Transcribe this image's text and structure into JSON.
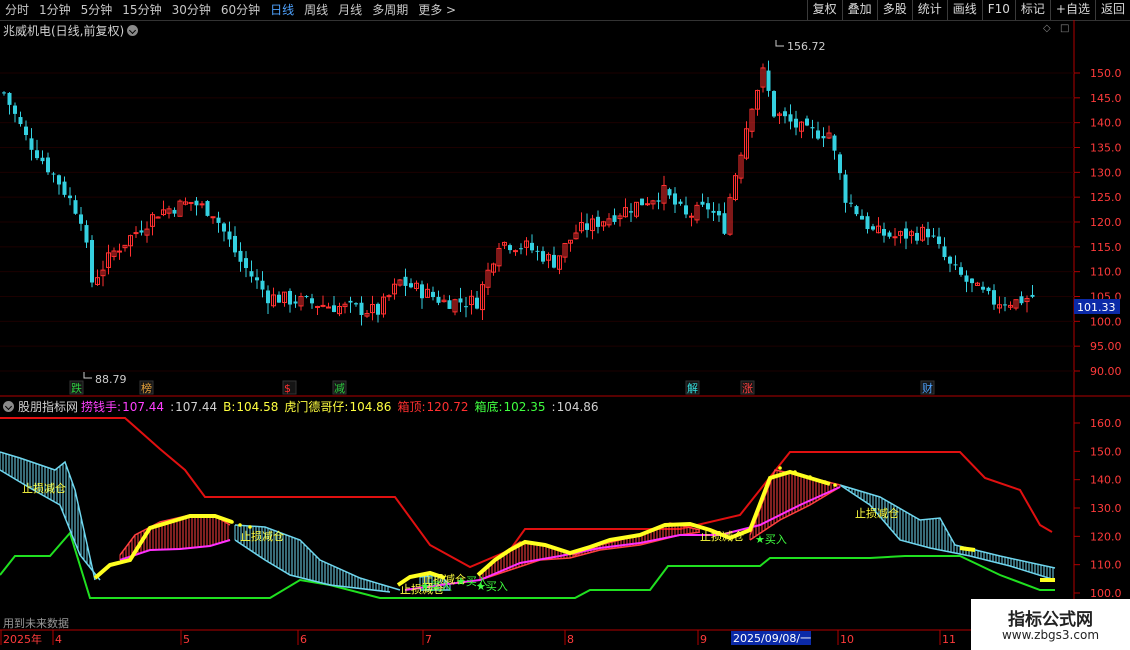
{
  "toolbar": {
    "periods": [
      {
        "label": "分时",
        "active": false
      },
      {
        "label": "1分钟",
        "active": false
      },
      {
        "label": "5分钟",
        "active": false
      },
      {
        "label": "15分钟",
        "active": false
      },
      {
        "label": "30分钟",
        "active": false
      },
      {
        "label": "60分钟",
        "active": false
      },
      {
        "label": "日线",
        "active": true
      },
      {
        "label": "周线",
        "active": false
      },
      {
        "label": "月线",
        "active": false
      },
      {
        "label": "多周期",
        "active": false
      },
      {
        "label": "更多 >",
        "active": false
      }
    ],
    "buttons": [
      "复权",
      "叠加",
      "多股",
      "统计",
      "画线",
      "F10",
      "标记",
      "+自选",
      "返回"
    ]
  },
  "stock": {
    "title": "兆威机电(日线,前复权)",
    "high_label": "156.72",
    "low_label": "88.79",
    "current_price": "101.33",
    "price_ticks": [
      "150.0",
      "145.0",
      "140.0",
      "135.0",
      "130.0",
      "125.0",
      "120.0",
      "115.0",
      "110.0",
      "105.0",
      "100.0",
      "95.00",
      "90.00"
    ],
    "event_markers": [
      {
        "text": "跌",
        "color": "#2ecc40"
      },
      {
        "text": "榜",
        "color": "#e6a23c"
      },
      {
        "text": "$",
        "color": "#ff3030"
      },
      {
        "text": "减",
        "color": "#2ecc40"
      },
      {
        "text": "解",
        "color": "#35e0e0"
      },
      {
        "text": "涨",
        "color": "#ff4040"
      },
      {
        "text": "财",
        "color": "#4fa3ff"
      }
    ]
  },
  "indicator": {
    "name": "股朋指标网",
    "items": [
      {
        "label": "捞钱手:",
        "value": "107.44",
        "color": "#ff40ff"
      },
      {
        "label": ":",
        "value": "107.44",
        "color": "#d0d0d0"
      },
      {
        "label": "B:",
        "value": "104.58",
        "color": "#ffff40"
      },
      {
        "label": "虎门德哥仔:",
        "value": "104.86",
        "color": "#ffff40"
      },
      {
        "label": "箱顶:",
        "value": "120.72",
        "color": "#ff3030"
      },
      {
        "label": "箱底:",
        "value": "102.35",
        "color": "#40ff40"
      },
      {
        "label": ":",
        "value": "104.86",
        "color": "#d0d0d0"
      }
    ],
    "ticks": [
      "160.0",
      "150.0",
      "140.0",
      "130.0",
      "120.0",
      "110.0",
      "100.0"
    ],
    "labels": [
      {
        "text": "止损减仓",
        "color": "#ffff40"
      },
      {
        "text": "止损减仓",
        "color": "#ffff40"
      },
      {
        "text": "止损减仓",
        "color": "#ffff40"
      },
      {
        "text": "止损减仓",
        "color": "#ffff40"
      },
      {
        "text": "止损减仓",
        "color": "#ffff40"
      },
      {
        "text": "止损减仓",
        "color": "#ffff40"
      },
      {
        "text": "★买入",
        "color": "#40ff40"
      },
      {
        "text": "★买入",
        "color": "#40ff40"
      },
      {
        "text": "★买入",
        "color": "#40ff40"
      },
      {
        "text": "★买入",
        "color": "#40ff40"
      }
    ],
    "future_note": "用到未来数据"
  },
  "time_axis": {
    "labels": [
      "2025年",
      "4",
      "5",
      "6",
      "7",
      "8",
      "9",
      "10",
      "11"
    ],
    "highlight": "2025/09/08/一"
  },
  "watermark": {
    "line1": "指标公式网",
    "line2": "www.zbgs3.com"
  },
  "colors": {
    "up": "#ff3030",
    "down": "#35d0e0",
    "box_top": "#e01010",
    "box_bottom": "#20e020",
    "thick": "#ffff20",
    "magenta": "#ff30ff"
  }
}
